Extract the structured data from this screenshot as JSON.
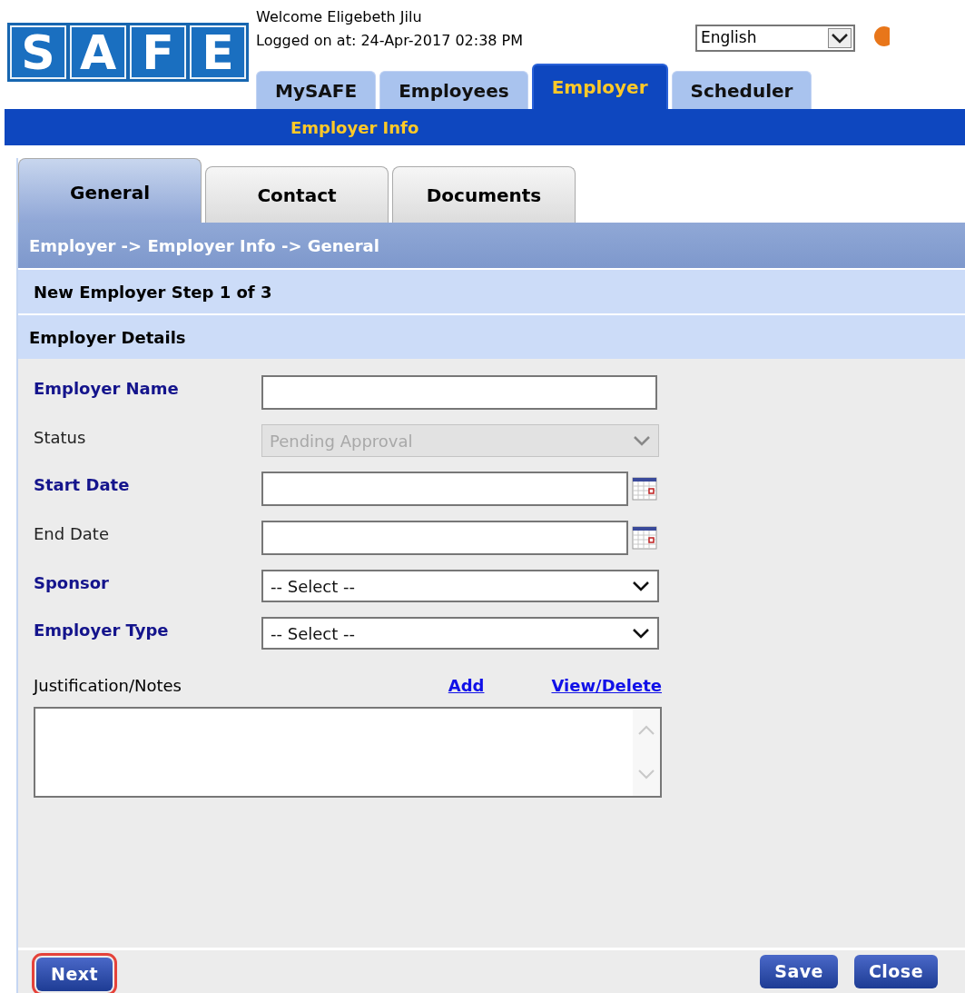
{
  "header": {
    "logo_letters": [
      "S",
      "A",
      "F",
      "E"
    ],
    "welcome": "Welcome Eligebeth Jilu",
    "logged_on": "Logged on at: 24-Apr-2017 02:38 PM",
    "language": "English"
  },
  "main_tabs": [
    {
      "label": "MySAFE",
      "selected": false
    },
    {
      "label": "Employees",
      "selected": false
    },
    {
      "label": "Employer",
      "selected": true
    },
    {
      "label": "Scheduler",
      "selected": false
    }
  ],
  "sub_nav": [
    "Employer Info"
  ],
  "section_tabs": [
    {
      "label": "General",
      "selected": true
    },
    {
      "label": "Contact",
      "selected": false
    },
    {
      "label": "Documents",
      "selected": false
    }
  ],
  "breadcrumb": "Employer -> Employer Info -> General",
  "step_title": "New Employer Step 1 of 3",
  "section_title": "Employer Details",
  "fields": [
    {
      "kind": "text",
      "label": "Employer Name",
      "required": true
    },
    {
      "kind": "select",
      "label": "Status",
      "required": false,
      "value": "Pending Approval",
      "disabled": true
    },
    {
      "kind": "date",
      "label": "Start Date",
      "required": true
    },
    {
      "kind": "date",
      "label": "End Date",
      "required": false
    },
    {
      "kind": "select",
      "label": "Sponsor",
      "required": true,
      "value": "-- Select --",
      "disabled": false
    },
    {
      "kind": "select",
      "label": "Employer Type",
      "required": true,
      "value": "-- Select --",
      "disabled": false
    }
  ],
  "notes": {
    "label": "Justification/Notes",
    "links": [
      "Add",
      "View/Delete"
    ]
  },
  "footer": {
    "left_buttons": [
      {
        "label": "Next",
        "highlighted": true
      }
    ],
    "right_buttons": [
      {
        "label": "Save",
        "highlighted": false
      },
      {
        "label": "Close",
        "highlighted": false
      }
    ]
  }
}
